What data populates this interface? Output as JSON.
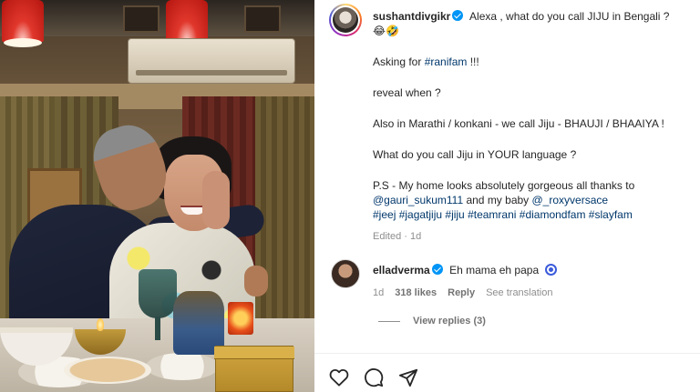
{
  "post": {
    "username": "sushantdivgikr",
    "caption_lines": [
      "Alexa , what do you call JIJU in Bengali ?",
      "😂🤣",
      "",
      "Asking for ",
      "",
      "reveal when ?",
      "",
      "Also in Marathi / konkani - we call Jiju - BHAUJI / BHAAIYA !",
      "",
      "What do you call Jiju in YOUR language ?",
      "",
      "P.S - My home looks absolutely gorgeous all thanks to",
      "@gauri_sukum111 and my baby @_roxyversace",
      "#jeej #jagatjiju #jiju #teamrani #diamondfam #slayfam"
    ],
    "hashtag_ranifam": "#ranifam",
    "after_ranifam": " !!!",
    "emoji_pair": "😂🤣",
    "mention_line_prefix": "",
    "mention_gauri": "@gauri_sukum111",
    "mention_mid": " and my baby ",
    "mention_roxy": "@_roxyversace",
    "hashtags": "#jeej #jagatjiju #jiju #teamrani #diamondfam #slayfam",
    "meta": "Edited · 1d"
  },
  "comment": {
    "username": "elladverma",
    "text": "Eh mama eh papa",
    "time": "1d",
    "likes": "318 likes",
    "reply": "Reply",
    "see_translation": "See translation",
    "view_replies": "View replies (3)"
  },
  "icons": {
    "verified": "verified-badge-icon",
    "heart": "heart-icon",
    "comment": "comment-icon",
    "share": "share-icon"
  },
  "colors": {
    "link": "#00376b",
    "verified": "#0095f6",
    "meta": "#8e8e8e"
  }
}
